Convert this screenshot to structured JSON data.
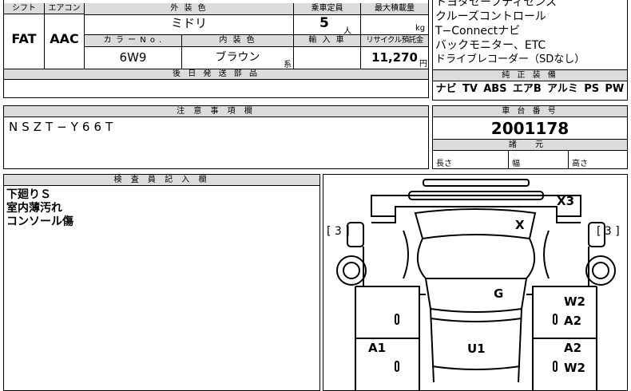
{
  "top_table": {
    "headers": {
      "shift": "シフト",
      "aircon": "エアコン",
      "exterior_color": "外 装 色",
      "capacity": "乗車定員",
      "max_load": "最大積載量",
      "color_no": "カ ラ ー  N o .",
      "interior_color": "内 装 色",
      "import_car": "輸 入 車",
      "recycle_fee": "リサイクル預託金"
    },
    "values": {
      "shift": "FAT",
      "aircon": "AAC",
      "exterior_color": "ミドリ",
      "capacity": "5",
      "capacity_unit": "人",
      "max_load_unit": "kg",
      "color_no": "6W9",
      "interior_color": "ブラウン",
      "interior_suffix": "系",
      "recycle_fee": "11,270",
      "recycle_unit": "円"
    },
    "later_parts_header": "後 日 発 送 部 品"
  },
  "equipment_notes": [
    "トヨタセーフティセンス",
    "クルーズコントロール",
    "T−Connectナビ",
    "バックモニター、ETC",
    "ドライブレコーダー（SDなし）"
  ],
  "standard_equipment": {
    "header": "純 正 装 備",
    "items": [
      "ナビ",
      "TV",
      "ABS",
      "エアB",
      "アルミ",
      "PS",
      "PW"
    ]
  },
  "notes": {
    "header": "注 意 事 項 欄",
    "text": "NSZT−Y66T"
  },
  "chassis": {
    "header": "車 台 番 号",
    "number": "2001178",
    "spec_header": "諸 元",
    "length_label": "長さ",
    "width_label": "幅",
    "height_label": "高さ"
  },
  "inspector": {
    "header": "検 査 員 記 入 欄",
    "lines": [
      "下廻りＳ",
      "室内薄汚れ",
      "コンソール傷"
    ]
  },
  "diagram": {
    "marks": {
      "x3": "X3",
      "x": "X",
      "left_bracket": "[ 3 ]",
      "right_bracket": "[ 3 ]",
      "g": "G",
      "w2_top": "W2",
      "a2_top": "A2",
      "a1": "A1",
      "u1": "U1",
      "a2_bottom": "A2",
      "w2_bottom": "W2"
    }
  }
}
